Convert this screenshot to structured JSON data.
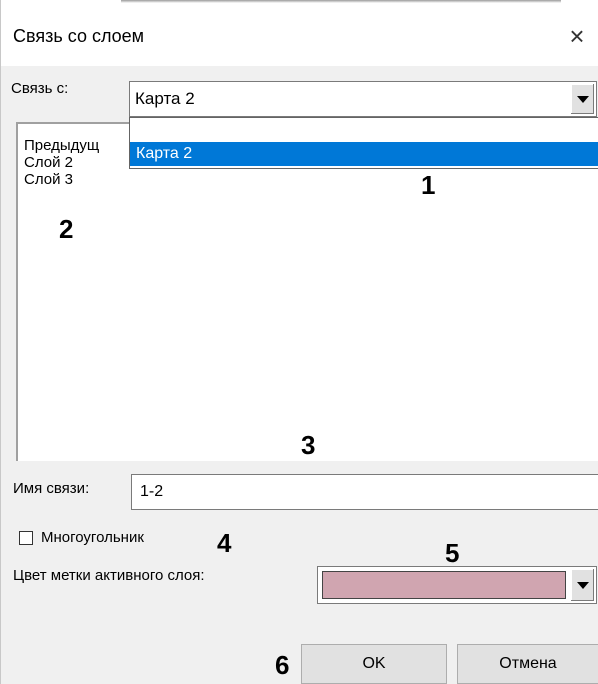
{
  "dialog": {
    "title": "Связь со слоем",
    "close_glyph": "×"
  },
  "link_with": {
    "label": "Связь с:",
    "value": "Карта 2"
  },
  "layers_list": {
    "items": [
      "Предыдущ",
      "Слой 2",
      "Слой 3"
    ]
  },
  "dropdown": {
    "options": [
      "",
      "Карта 2"
    ],
    "highlighted": "Карта 2"
  },
  "link_name": {
    "label": "Имя связи:",
    "value": "1-2"
  },
  "polygon": {
    "label": "Многоугольник",
    "checked": false
  },
  "color": {
    "label": "Цвет метки активного слоя:",
    "value": "#d0a5b0"
  },
  "buttons": {
    "ok": "OK",
    "cancel": "Отмена"
  },
  "markers": [
    "1",
    "2",
    "3",
    "4",
    "5",
    "6"
  ],
  "icons": {
    "close": "close-icon",
    "dropdown_arrow": "chevron-down-icon"
  }
}
